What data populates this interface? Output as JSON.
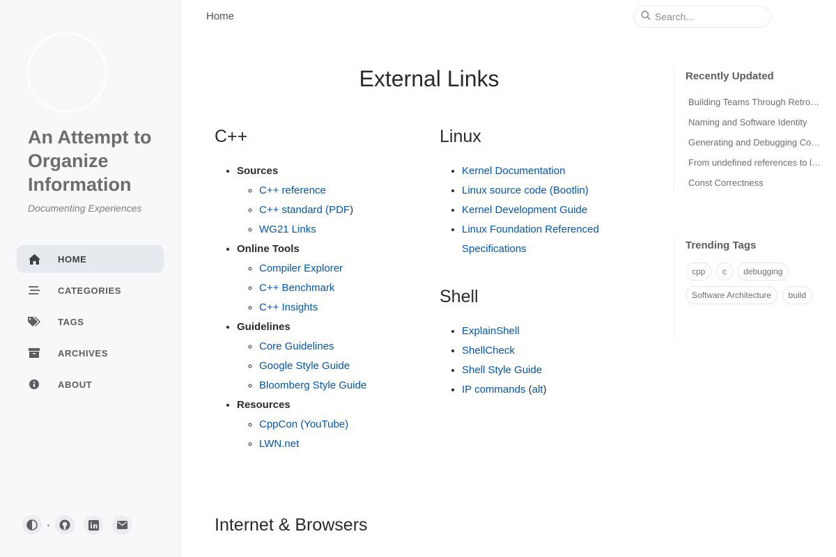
{
  "sidebar": {
    "title": "An Attempt to Organize Information",
    "subtitle": "Documenting Experiences",
    "nav": [
      {
        "label": "HOME",
        "icon": "home-icon",
        "active": true
      },
      {
        "label": "CATEGORIES",
        "icon": "stream-icon",
        "active": false
      },
      {
        "label": "TAGS",
        "icon": "tags-icon",
        "active": false
      },
      {
        "label": "ARCHIVES",
        "icon": "archive-icon",
        "active": false
      },
      {
        "label": "ABOUT",
        "icon": "info-circle-icon",
        "active": false
      }
    ],
    "bottom_icons": [
      "theme-toggle-icon",
      "github-icon",
      "linkedin-icon",
      "email-icon"
    ]
  },
  "topbar": {
    "breadcrumb": "Home",
    "search_placeholder": "Search..."
  },
  "main": {
    "title": "External Links",
    "cpp": {
      "heading": "C++",
      "groups": [
        {
          "label": "Sources",
          "items": [
            "C++ reference",
            "C++ standard (PDF)",
            "WG21 Links"
          ]
        },
        {
          "label": "Online Tools",
          "items": [
            "Compiler Explorer",
            "C++ Benchmark",
            "C++ Insights"
          ]
        },
        {
          "label": "Guidelines",
          "items": [
            "Core Guidelines",
            "Google Style Guide",
            "Bloomberg Style Guide"
          ]
        },
        {
          "label": "Resources",
          "items": [
            "CppCon (YouTube)",
            "LWN.net"
          ]
        }
      ],
      "standard_prefix": "C++ standard (",
      "standard_link": "PDF",
      "standard_suffix": ")"
    },
    "linux": {
      "heading": "Linux",
      "items": [
        "Kernel Documentation",
        "Linux source code (Bootlin)",
        "Kernel Development Guide",
        "Linux Foundation Referenced Specifications"
      ]
    },
    "shell": {
      "heading": "Shell",
      "items": [
        "ExplainShell",
        "ShellCheck",
        "Shell Style Guide"
      ],
      "ip_link": "IP commands",
      "ip_open": " (",
      "ip_alt": "alt",
      "ip_close": ")"
    },
    "internet": {
      "heading": "Internet & Browsers"
    }
  },
  "panel": {
    "recently_updated_title": "Recently Updated",
    "recently_updated": [
      "Building Teams Through Retrospectives",
      "Naming and Software Identity",
      "Generating and Debugging Core Dumps",
      "From undefined references to linking",
      "Const Correctness"
    ],
    "trending_tags_title": "Trending Tags",
    "tags": [
      "cpp",
      "c",
      "debugging",
      "Software Architecture",
      "build"
    ]
  },
  "colors": {
    "link": "#0056b2",
    "sidebar_bg": "#f6f8fa",
    "active_nav_bg": "#e6e9ed"
  }
}
